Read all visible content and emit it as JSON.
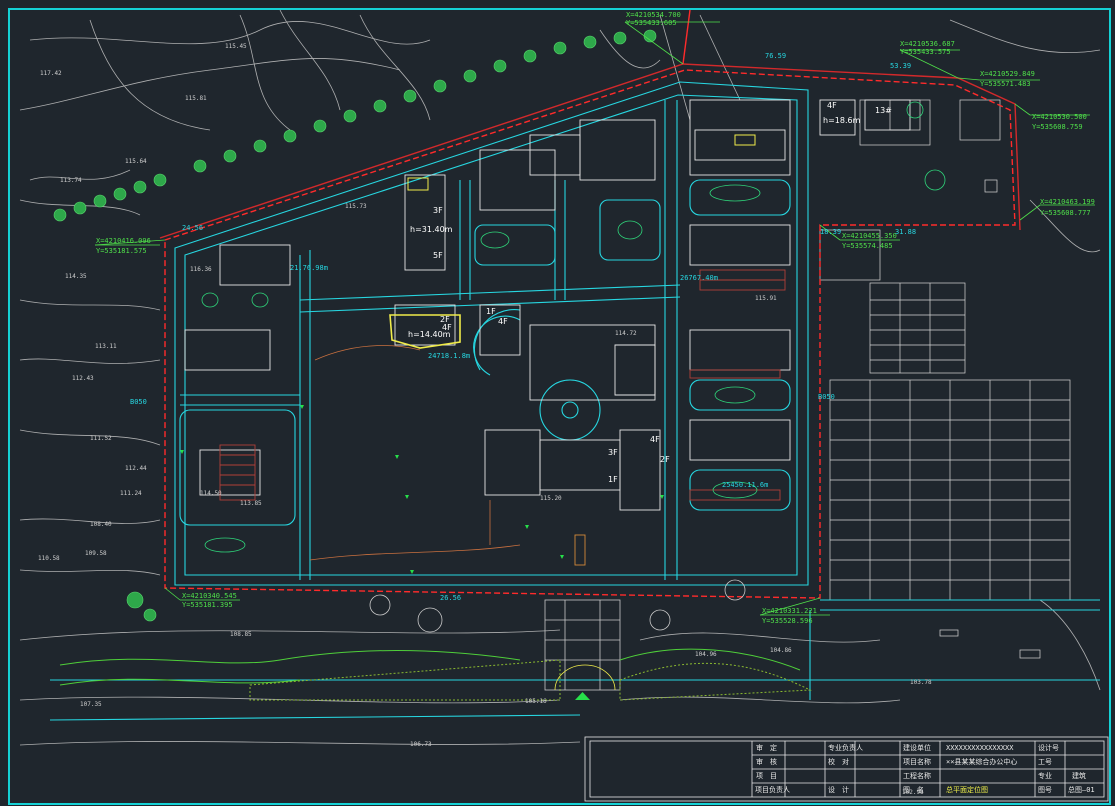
{
  "coords": [
    {
      "x": "X=4210534.700",
      "y": "Y=535433.605"
    },
    {
      "x": "X=4210536.687",
      "y": "Y=535433.575"
    },
    {
      "x": "X=4210529.849",
      "y": "Y=535571.483"
    },
    {
      "x": "X=4210530.500",
      "y": "Y=535608.759"
    },
    {
      "x": "X=4210463.199",
      "y": "Y=535608.777"
    },
    {
      "x": "X=4210455.350",
      "y": "Y=535574.485"
    },
    {
      "x": "X=4210416.096",
      "y": "Y=535181.575"
    },
    {
      "x": "X=4210340.545",
      "y": "Y=535181.395"
    },
    {
      "x": "X=4210331.221",
      "y": "Y=535528.596"
    }
  ],
  "buildings": {
    "b_3f_top": "3F",
    "b_h_tall": "h=31.40m",
    "b_5f": "5F",
    "b_h_center": "h=14.40m",
    "b_2f": "2F",
    "b_4f": "4F",
    "b_1f": "1F",
    "b_4f_right": "4F",
    "b_h_right": "h=18.6m",
    "b_13f": "13#",
    "b_3f_mid": "3F",
    "b_4f_low": "4F",
    "b_1f_low": "1F",
    "b_2f_low": "2F"
  },
  "dims": {
    "d1": "26767.40m",
    "d2": "25450.11.6m",
    "d3": "24718.1.8m",
    "d4": "21.76.98m",
    "d5": "18.39",
    "d6": "31.88",
    "d7": "76.59",
    "d8": "53.39",
    "d9": "24.56",
    "d10": "26.56",
    "d11": "B050",
    "d12": "B050"
  },
  "spots": [
    "115.45",
    "117.42",
    "115.81",
    "115.64",
    "113.74",
    "115.73",
    "114.35",
    "116.36",
    "113.11",
    "112.43",
    "112.44",
    "111.52",
    "111.24",
    "110.58",
    "109.58",
    "108.40",
    "108.85",
    "107.35",
    "106.73",
    "105.16",
    "104.96",
    "103.78",
    "102.96",
    "104.86",
    "114.50",
    "113.85",
    "115.20",
    "114.72",
    "115.91"
  ],
  "title_block": {
    "r1": [
      "审　定",
      "",
      "专业负责人",
      "",
      "建设单位",
      "XXXXXXXXXXXXXXXX",
      "设计号",
      ""
    ],
    "r2": [
      "审　核",
      "",
      "校　对",
      "",
      "项目名称",
      "××县某某综合办公中心",
      "工号",
      ""
    ],
    "r3": [
      "项　目",
      "",
      "",
      "",
      "工程名称",
      "",
      "专业",
      "建筑"
    ],
    "r4": [
      "项目负责人",
      "",
      "设　计",
      "",
      "图　名",
      "总平面定位图",
      "图号",
      "总图—01"
    ]
  }
}
